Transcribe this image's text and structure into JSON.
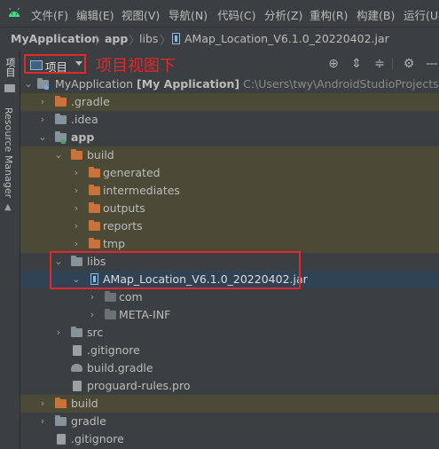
{
  "menubar": {
    "items": [
      "文件(F)",
      "编辑(E)",
      "视图(V)",
      "导航(N)",
      "代码(C)",
      "分析(Z)",
      "重构(R)",
      "构建(B)",
      "运行(U)"
    ]
  },
  "breadcrumb": {
    "items": [
      "MyApplication",
      "app",
      "libs",
      "AMap_Location_V6.1.0_20220402.jar"
    ]
  },
  "left_strip": {
    "project_tab": "项目",
    "resource_manager": "Resource Manager"
  },
  "panel": {
    "view_selector": "项目",
    "annotation": "项目视图下"
  },
  "tree": {
    "root_name": "MyApplication",
    "root_module": "[My Application]",
    "root_path": "C:\\Users\\twy\\AndroidStudioProjects\\MyApplication",
    "rows": [
      ".gradle",
      ".idea",
      "app",
      "build",
      "generated",
      "intermediates",
      "outputs",
      "reports",
      "tmp",
      "libs",
      "AMap_Location_V6.1.0_20220402.jar",
      "com",
      "META-INF",
      "src",
      ".gitignore",
      "build.gradle",
      "proguard-rules.pro",
      "build",
      "gradle",
      ".gitignore"
    ]
  },
  "colors": {
    "annotation_red": "#e0282e",
    "selection": "#2f4355",
    "excluded_folder": "#c9733c"
  }
}
